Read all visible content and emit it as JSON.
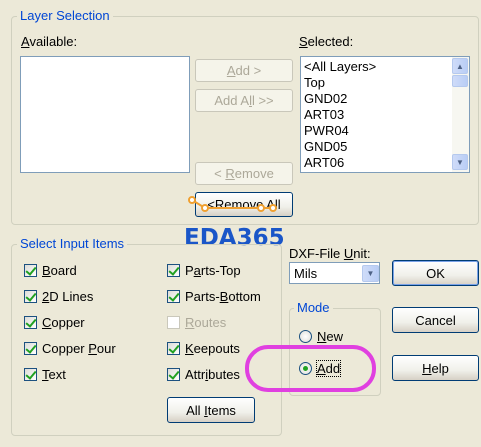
{
  "layer_selection": {
    "title": "Layer Selection",
    "available_label": "Available:",
    "selected_label": "Selected:",
    "available_items": [],
    "selected_items": [
      "<All Layers>",
      "Top",
      "GND02",
      "ART03",
      "PWR04",
      "GND05",
      "ART06"
    ],
    "add_button": "Add >",
    "add_all_button": "Add All >>",
    "remove_button": "< Remove",
    "remove_all_button": "<Remove All"
  },
  "watermark": {
    "text": "EDA365",
    "color": "#1a56c8"
  },
  "input_items": {
    "title": "Select Input Items",
    "items": [
      {
        "label": "Board",
        "checked": true,
        "enabled": true
      },
      {
        "label": "2D Lines",
        "checked": true,
        "enabled": true
      },
      {
        "label": "Copper",
        "checked": true,
        "enabled": true
      },
      {
        "label": "Copper Pour",
        "checked": true,
        "enabled": true
      },
      {
        "label": "Text",
        "checked": true,
        "enabled": true
      },
      {
        "label": "Parts-Top",
        "checked": true,
        "enabled": true
      },
      {
        "label": "Parts-Bottom",
        "checked": true,
        "enabled": true
      },
      {
        "label": "Routes",
        "checked": false,
        "enabled": false
      },
      {
        "label": "Keepouts",
        "checked": true,
        "enabled": true
      },
      {
        "label": "Attributes",
        "checked": true,
        "enabled": true
      }
    ],
    "all_items_button": "All Items"
  },
  "dxf_unit": {
    "label": "DXF-File Unit:",
    "value": "Mils"
  },
  "mode": {
    "title": "Mode",
    "options": [
      {
        "label": "New",
        "selected": false
      },
      {
        "label": "Add",
        "selected": true
      }
    ]
  },
  "buttons": {
    "ok": "OK",
    "cancel": "Cancel",
    "help": "Help"
  },
  "annotation": {
    "color": "#e040e0",
    "handle_color": "#f0a030"
  }
}
